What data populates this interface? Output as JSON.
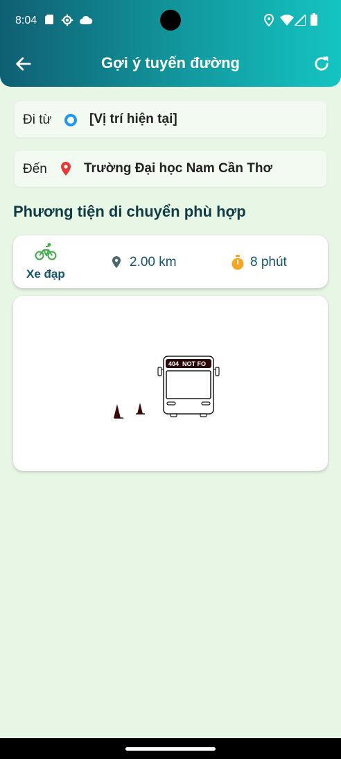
{
  "status_bar": {
    "time": "8:04"
  },
  "header": {
    "title": "Gợi ý tuyến đường"
  },
  "route": {
    "from_label": "Đi từ",
    "from_value": "[Vị trí hiện tại]",
    "to_label": "Đến",
    "to_value": "Trường Đại học Nam Cần Thơ"
  },
  "section": {
    "title": "Phương tiện di chuyển phù hợp"
  },
  "summary": {
    "mode_label": "Xe đạp",
    "distance": "2.00 km",
    "duration": "8 phút"
  },
  "map": {
    "error_sign": "404  NOT FO"
  },
  "colors": {
    "appbar_start": "#0f5f72",
    "appbar_end": "#14c4c2",
    "background": "#e8f6e6",
    "accent_text": "#13556a",
    "bike_icon": "#3fae49",
    "timer_icon": "#f5a623",
    "location_pin": "#e53935",
    "origin_ring": "#2196f3"
  },
  "icons": {
    "back": "arrow-left-icon",
    "refresh": "refresh-icon",
    "origin": "origin-ring-icon",
    "destination": "location-pin-icon",
    "bike": "bicycle-icon",
    "distance": "place-icon",
    "time": "timer-icon"
  }
}
